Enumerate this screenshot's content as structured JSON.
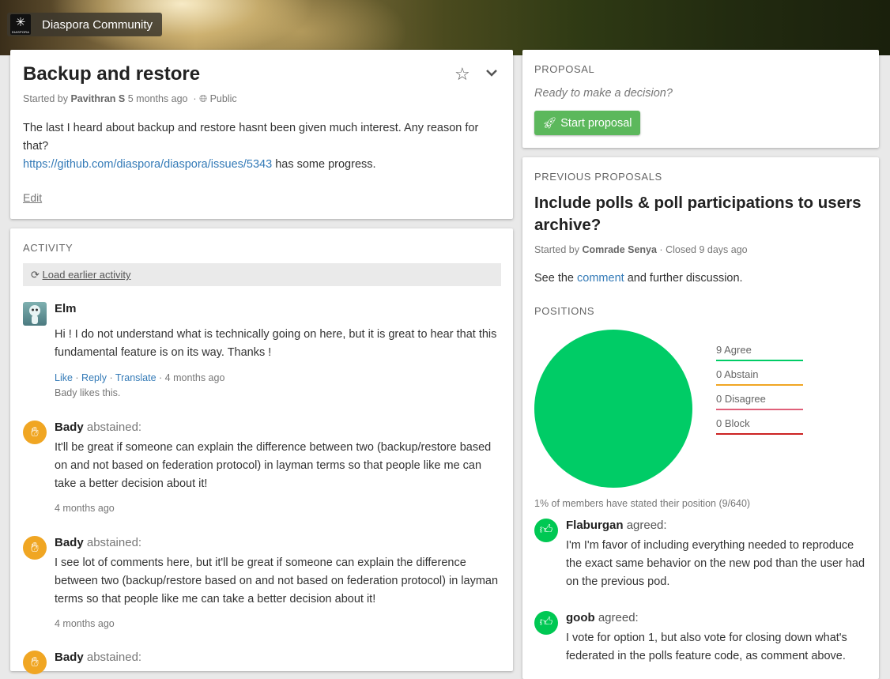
{
  "brand": {
    "name": "Diaspora Community",
    "logo_text": "DIASPORA"
  },
  "context": {
    "title": "Backup and restore",
    "meta_prefix": "Started by",
    "author": "Pavithran S",
    "time": "5 months ago",
    "visibility": "Public",
    "body_line1": "The last I heard about backup and restore hasnt been given much interest. Any reason for that?",
    "link": "https://github.com/diaspora/diaspora/issues/5343",
    "body_line2_suffix": "has some progress.",
    "edit_label": "Edit"
  },
  "activity": {
    "label": "Activity",
    "load_earlier": "Load earlier activity",
    "events": [
      {
        "author": "Elm",
        "verb": "",
        "body": "Hi ! I do not understand what is technically going on here, but it is great to hear that this fundamental feature is on its way. Thanks !",
        "actions": [
          "Like",
          "Reply",
          "Translate"
        ],
        "time": "4 months ago",
        "likes": "Bady likes this."
      },
      {
        "author": "Bady",
        "verb": "abstained:",
        "body": "It'll be great if someone can explain the difference between two (backup/restore based on and not based on federation protocol) in layman terms so that people like me can take a better decision about it!",
        "time": "4 months ago"
      },
      {
        "author": "Bady",
        "verb": "abstained:",
        "body": "I see lot of comments here, but it'll be great if someone can explain the difference between two (backup/restore based on and not based on federation protocol) in layman terms so that people like me can take a better decision about it!",
        "time": "4 months ago"
      },
      {
        "author": "Bady",
        "verb": "abstained:"
      }
    ]
  },
  "proposal": {
    "label": "Proposal",
    "question": "Ready to make a decision?",
    "start_button": "Start proposal"
  },
  "previous": {
    "label": "Previous proposals",
    "title": "Include polls & poll participations to users archive?",
    "meta_prefix": "Started by",
    "author": "Comrade Senya",
    "status": "Closed 9 days ago",
    "desc_prefix": "See the",
    "desc_link": "comment",
    "desc_suffix": "and further discussion.",
    "positions_label": "Positions",
    "stat_line": "1% of members have stated their position (9/640)",
    "positions": [
      {
        "label": "9 Agree",
        "count": 9,
        "color": "#00cc66"
      },
      {
        "label": "0 Abstain",
        "count": 0,
        "color": "#f0a623"
      },
      {
        "label": "0 Disagree",
        "count": 0,
        "color": "#e0607a"
      },
      {
        "label": "0 Block",
        "count": 0,
        "color": "#cc2222"
      }
    ],
    "position_events": [
      {
        "author": "Flaburgan",
        "verb": "agreed:",
        "body": "I'm I'm favor of including everything needed to reproduce the exact same behavior on the new pod than the user had on the previous pod."
      },
      {
        "author": "goob",
        "verb": "agreed:",
        "body": "I vote for option 1, but also vote for closing down what's federated in the polls feature code, as comment above."
      }
    ]
  }
}
